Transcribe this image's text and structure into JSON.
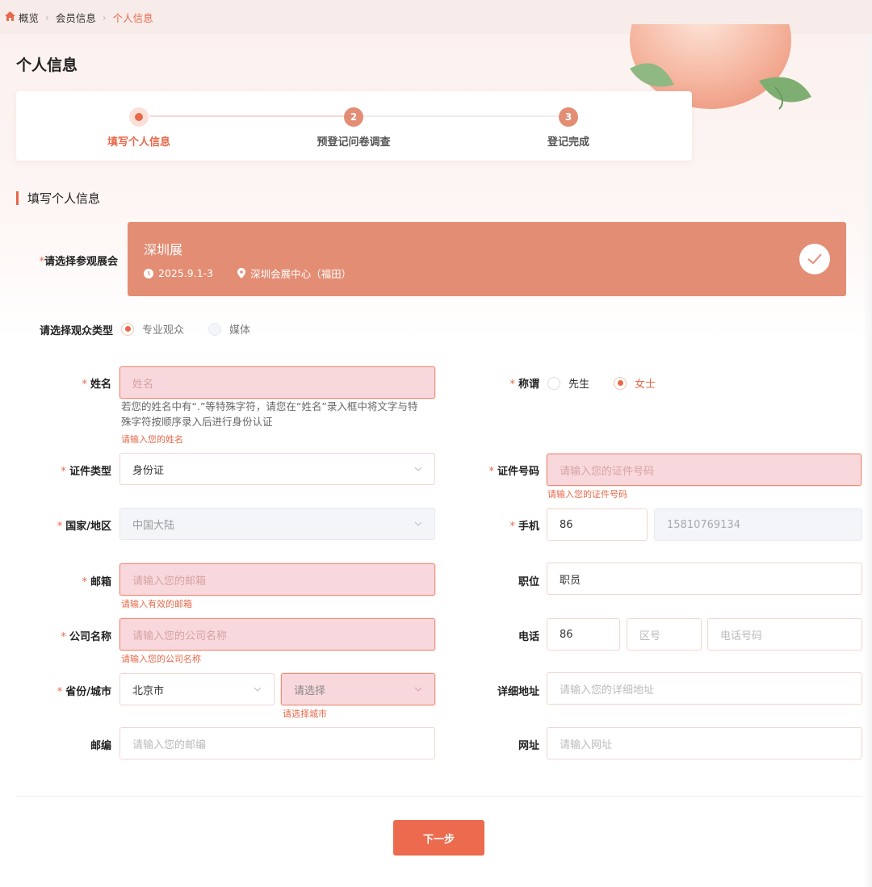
{
  "breadcrumb": {
    "home": "概览",
    "level2": "会员信息",
    "current": "个人信息"
  },
  "page_title": "个人信息",
  "steps": [
    {
      "num": "",
      "label": "填写个人信息"
    },
    {
      "num": "2",
      "label": "预登记问卷调查"
    },
    {
      "num": "3",
      "label": "登记完成"
    }
  ],
  "section_title": "填写个人信息",
  "expo": {
    "label": "请选择参观展会",
    "name": "深圳展",
    "date": "2025.9.1-3",
    "location": "深圳会展中心（福田）"
  },
  "audience": {
    "label": "请选择观众类型",
    "options": [
      "专业观众",
      "媒体"
    ],
    "selected": "专业观众"
  },
  "name": {
    "label": "姓名",
    "placeholder": "姓名",
    "hint1": "若您的姓名中有“.”等特殊字符，请您在“姓名”录入框中将文字与特",
    "hint2": "殊字符按顺序录入后进行身份认证",
    "error": "请输入您的姓名"
  },
  "title": {
    "label": "称谓",
    "options": [
      "先生",
      "女士"
    ],
    "selected": "女士"
  },
  "id_type": {
    "label": "证件类型",
    "value": "身份证"
  },
  "id_number": {
    "label": "证件号码",
    "placeholder": "请输入您的证件号码",
    "error": "请输入您的证件号码"
  },
  "country": {
    "label": "国家/地区",
    "value": "中国大陆"
  },
  "mobile": {
    "label": "手机",
    "code": "86",
    "number": "15810769134"
  },
  "email": {
    "label": "邮箱",
    "placeholder": "请输入您的邮箱",
    "error": "请输入有效的邮箱"
  },
  "position": {
    "label": "职位",
    "value": "职员"
  },
  "company": {
    "label": "公司名称",
    "placeholder": "请输入您的公司名称",
    "error": "请输入您的公司名称"
  },
  "phone": {
    "label": "电话",
    "code": "86",
    "area_placeholder": "区号",
    "number_placeholder": "电话号码"
  },
  "province": {
    "label": "省份/城市",
    "value": "北京市",
    "city_placeholder": "请选择",
    "error": "请选择城市"
  },
  "address": {
    "label": "详细地址",
    "placeholder": "请输入您的详细地址"
  },
  "postcode": {
    "label": "邮编",
    "placeholder": "请输入您的邮编"
  },
  "website": {
    "label": "网址",
    "placeholder": "请输入网址"
  },
  "next_button": "下一步",
  "colors": {
    "accent": "#e8684a",
    "expo_card": "#e38d74",
    "error_bg": "#f8d8dc"
  }
}
